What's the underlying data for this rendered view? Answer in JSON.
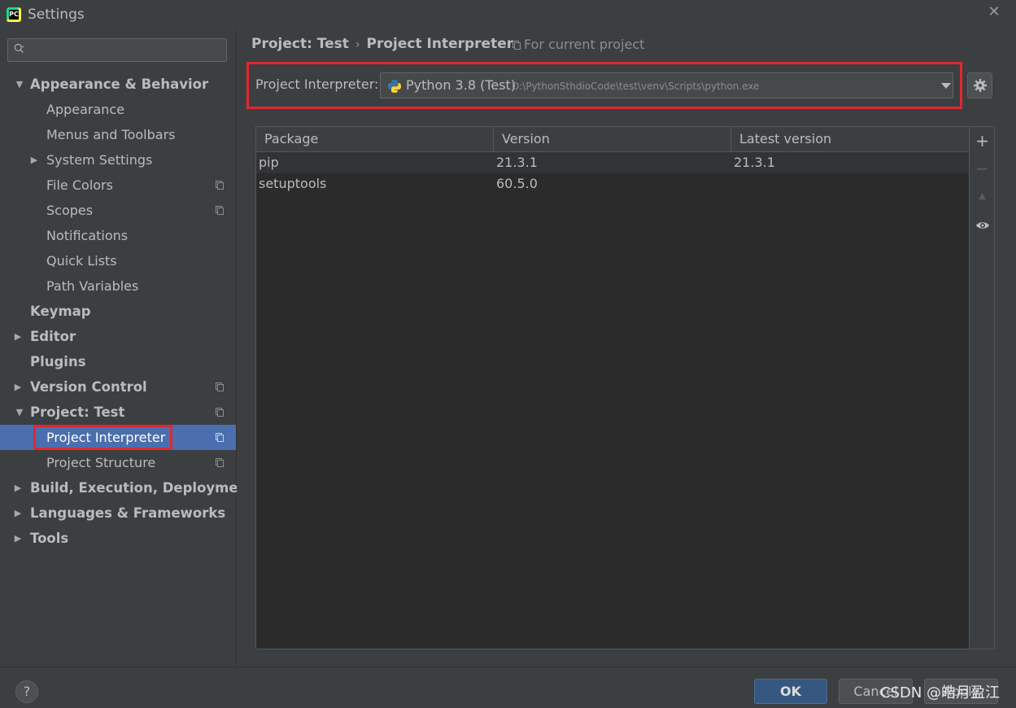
{
  "window": {
    "title": "Settings",
    "close_glyph": "✕",
    "app_icon": "pycharm-icon",
    "app_icon_text": "PC"
  },
  "sidebar": {
    "search": {
      "value": "",
      "placeholder": ""
    },
    "items": [
      {
        "label": "Appearance & Behavior",
        "expanded": true
      },
      {
        "label": "Appearance"
      },
      {
        "label": "Menus and Toolbars"
      },
      {
        "label": "System Settings"
      },
      {
        "label": "File Colors"
      },
      {
        "label": "Scopes"
      },
      {
        "label": "Notifications"
      },
      {
        "label": "Quick Lists"
      },
      {
        "label": "Path Variables"
      },
      {
        "label": "Keymap"
      },
      {
        "label": "Editor"
      },
      {
        "label": "Plugins"
      },
      {
        "label": "Version Control"
      },
      {
        "label": "Project: Test",
        "expanded": true
      },
      {
        "label": "Project Interpreter",
        "selected": true
      },
      {
        "label": "Project Structure"
      },
      {
        "label": "Build, Execution, Deployment"
      },
      {
        "label": "Languages & Frameworks"
      },
      {
        "label": "Tools"
      }
    ]
  },
  "breadcrumb": {
    "parent": "Project: Test",
    "separator": "›",
    "current": "Project Interpreter"
  },
  "scope": {
    "label": "For current project"
  },
  "interpreter": {
    "label": "Project Interpreter:",
    "name": "Python 3.8 (Test)",
    "path": "D:\\PythonSthdioCode\\test\\venv\\Scripts\\python.exe"
  },
  "packages": {
    "columns": [
      "Package",
      "Version",
      "Latest version"
    ],
    "rows": [
      {
        "package": "pip",
        "version": "21.3.1",
        "latest": "21.3.1"
      },
      {
        "package": "setuptools",
        "version": "60.5.0",
        "latest": ""
      }
    ]
  },
  "tools": {
    "add": "+",
    "remove": "−",
    "upgrade": "▲",
    "show_early": "eye-icon"
  },
  "footer": {
    "help": "?",
    "ok": "OK",
    "cancel": "Cancel",
    "apply": "Apply",
    "watermark": "CSDN @皓月盈江"
  },
  "colors": {
    "background": "#3c3f41",
    "selection": "#4b6eaf",
    "highlight": "#e0282f",
    "ok_button": "#365880"
  }
}
